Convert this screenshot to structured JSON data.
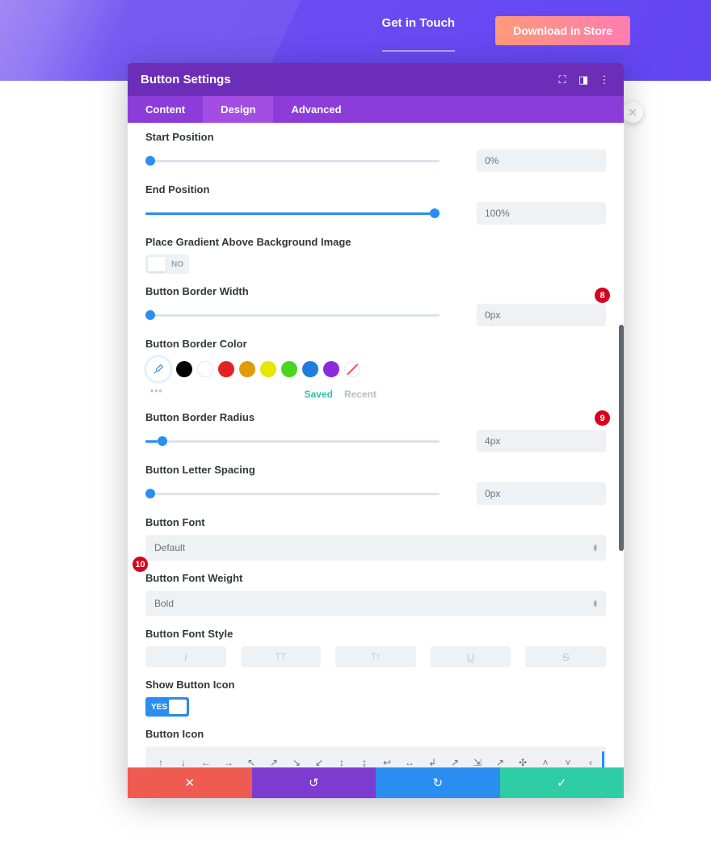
{
  "hero": {
    "get_in_touch": "Get in Touch",
    "download": "Download in Store"
  },
  "modal": {
    "title": "Button Settings",
    "header_icons": {
      "expand": "⛶",
      "columns": "◨",
      "more": "⋮"
    },
    "tabs": {
      "content": "Content",
      "design": "Design",
      "advanced": "Advanced"
    }
  },
  "labels": {
    "start_position": "Start Position",
    "end_position": "End Position",
    "gradient_above": "Place Gradient Above Background Image",
    "border_width": "Button Border Width",
    "border_color": "Button Border Color",
    "border_radius": "Button Border Radius",
    "letter_spacing": "Button Letter Spacing",
    "font": "Button Font",
    "font_weight": "Button Font Weight",
    "font_style": "Button Font Style",
    "show_icon": "Show Button Icon",
    "button_icon": "Button Icon"
  },
  "values": {
    "start_position": "0%",
    "end_position": "100%",
    "gradient_above": "NO",
    "border_width": "0px",
    "border_radius": "4px",
    "letter_spacing": "0px",
    "font": "Default",
    "font_weight": "Bold",
    "show_icon": "YES"
  },
  "palette": {
    "colors": [
      "#000000",
      "#ffffff",
      "#e02424",
      "#e09b0a",
      "#e6e600",
      "#4cd41f",
      "#1f7de0",
      "#8b2bdb"
    ],
    "saved": "Saved",
    "recent": "Recent"
  },
  "annotations": {
    "eight": "8",
    "nine": "9",
    "ten": "10"
  },
  "icons": {
    "r1": [
      "↑",
      "↓",
      "←",
      "→",
      "↖",
      "↗",
      "↘",
      "↙",
      "↕",
      "↨",
      "↩",
      "↔",
      "↲",
      "↗",
      "⇲",
      "↗",
      "✣",
      "˄",
      "˅",
      "‹"
    ],
    "r2": [
      "›",
      "ˆ",
      "ˇ",
      "«",
      "»",
      "⊝",
      "⊘",
      "⊙",
      "⊛",
      "⊜",
      "⊚",
      "⊗",
      "▴",
      "▾",
      "◂",
      "▸",
      "⊕",
      "⊖",
      "⊙",
      " "
    ],
    "r3": [
      "⊙",
      "↶",
      "−",
      "+",
      "×",
      "✓",
      "⊖",
      "⊕",
      "⊗",
      "⊘",
      "℗",
      "℗",
      "◯",
      "▢",
      "▣",
      "▤",
      "▥",
      "☑",
      "○",
      "◉"
    ],
    "r4": [
      "▢",
      "◫",
      "⏸",
      "⏴",
      "⏵",
      "⏹",
      "▢",
      "▣",
      "▢",
      "⬚",
      "▣",
      "▤",
      "▤",
      "▥",
      "▤",
      "⬓",
      "▥",
      "⬔",
      "▢",
      "⬓"
    ]
  }
}
